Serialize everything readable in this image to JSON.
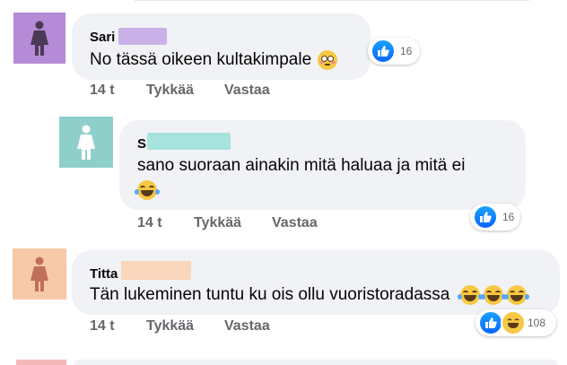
{
  "colors": {
    "avatar_purple": "#b58ad6",
    "avatar_teal": "#8fcfca",
    "avatar_peach": "#f6c9a8",
    "redact_purple": "#c9b1e8",
    "redact_teal": "#a8e2dc",
    "redact_peach": "#fad6bd",
    "like_blue": "#0866ff"
  },
  "comments": [
    {
      "avatar_icon": "female-figure-icon",
      "name": "Sari",
      "text": "No tässä oikeen kultakimpale",
      "emoji": "flushed-face-icon",
      "time": "14 t",
      "like_label": "Tykkää",
      "reply_label": "Vastaa",
      "reaction_count": "16",
      "reactions": [
        "like-icon"
      ]
    },
    {
      "avatar_icon": "female-figure-icon",
      "name": "S",
      "text": "sano suoraan ainakin mitä haluaa ja mitä ei",
      "emoji": "laughing-face-icon",
      "time": "14 t",
      "like_label": "Tykkää",
      "reply_label": "Vastaa",
      "reaction_count": "16",
      "reactions": [
        "like-icon"
      ]
    },
    {
      "avatar_icon": "female-figure-icon",
      "name": "Titta",
      "text": "Tän lukeminen tuntu ku ois ollu vuoristoradassa",
      "emoji": "laughing-face-icon",
      "time": "14 t",
      "like_label": "Tykkää",
      "reply_label": "Vastaa",
      "reaction_count": "108",
      "reactions": [
        "like-icon",
        "haha-icon"
      ]
    }
  ]
}
